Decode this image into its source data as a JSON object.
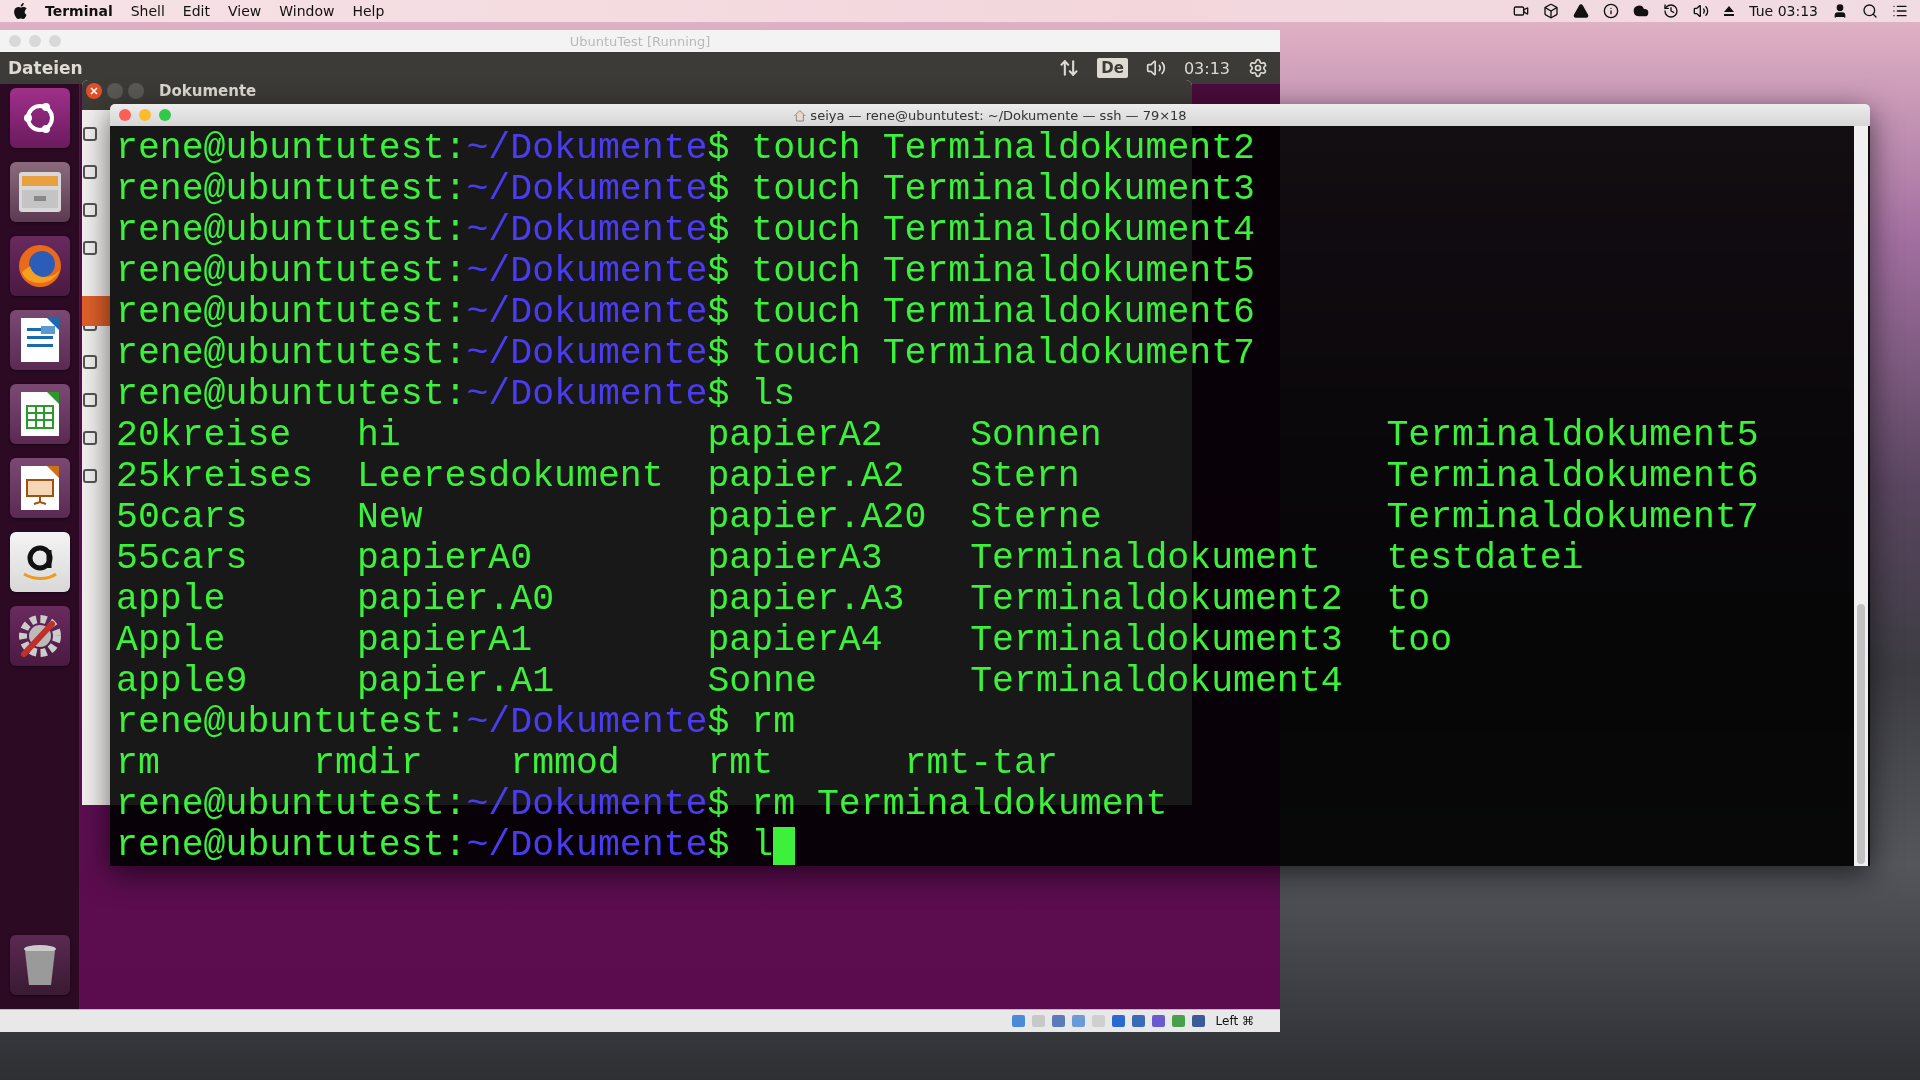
{
  "menu_bar": {
    "app": "Terminal",
    "items": [
      "Shell",
      "Edit",
      "View",
      "Window",
      "Help"
    ],
    "clock": "Tue 03:13"
  },
  "vm_window": {
    "title": "UbuntuTest [Running]",
    "panel_title": "Dateien",
    "keyboard_layout": "De",
    "clock": "03:13",
    "host_key": "Left ⌘"
  },
  "file_window": {
    "title": "Dokumente"
  },
  "terminal": {
    "title": "seiya — rene@ubuntutest: ~/Dokumente — ssh — 79×18",
    "lines": [
      {
        "kind": "prompt",
        "user_host": "rene@ubuntutest:",
        "path": "~/Dokumente",
        "symbol": "$",
        "command": "touch Terminaldokument2",
        "cursor": false
      },
      {
        "kind": "prompt",
        "user_host": "rene@ubuntutest:",
        "path": "~/Dokumente",
        "symbol": "$",
        "command": "touch Terminaldokument3",
        "cursor": false
      },
      {
        "kind": "prompt",
        "user_host": "rene@ubuntutest:",
        "path": "~/Dokumente",
        "symbol": "$",
        "command": "touch Terminaldokument4",
        "cursor": false
      },
      {
        "kind": "prompt",
        "user_host": "rene@ubuntutest:",
        "path": "~/Dokumente",
        "symbol": "$",
        "command": "touch Terminaldokument5",
        "cursor": false
      },
      {
        "kind": "prompt",
        "user_host": "rene@ubuntutest:",
        "path": "~/Dokumente",
        "symbol": "$",
        "command": "touch Terminaldokument6",
        "cursor": false
      },
      {
        "kind": "prompt",
        "user_host": "rene@ubuntutest:",
        "path": "~/Dokumente",
        "symbol": "$",
        "command": "touch Terminaldokument7",
        "cursor": false
      },
      {
        "kind": "prompt",
        "user_host": "rene@ubuntutest:",
        "path": "~/Dokumente",
        "symbol": "$",
        "command": "ls",
        "cursor": false
      },
      {
        "kind": "listing",
        "rows": [
          [
            "20kreise",
            "hi",
            "papierA2",
            "Sonnen",
            "Terminaldokument5"
          ],
          [
            "25kreises",
            "Leeresdokument",
            "papier.A2",
            "Stern",
            "Terminaldokument6"
          ],
          [
            "50cars",
            "New",
            "papier.A20",
            "Sterne",
            "Terminaldokument7"
          ],
          [
            "55cars",
            "papierA0",
            "papierA3",
            "Terminaldokument",
            "testdatei"
          ],
          [
            "apple",
            "papier.A0",
            "papier.A3",
            "Terminaldokument2",
            "to"
          ],
          [
            "Apple",
            "papierA1",
            "papierA4",
            "Terminaldokument3",
            "too"
          ],
          [
            "apple9",
            "papier.A1",
            "Sonne",
            "Terminaldokument4"
          ]
        ]
      },
      {
        "kind": "prompt",
        "user_host": "rene@ubuntutest:",
        "path": "~/Dokumente",
        "symbol": "$",
        "command": "rm",
        "cursor": false
      },
      {
        "kind": "completion",
        "items": [
          "rm",
          "rmdir",
          "rmmod",
          "rmt",
          "rmt-tar"
        ]
      },
      {
        "kind": "prompt",
        "user_host": "rene@ubuntutest:",
        "path": "~/Dokumente",
        "symbol": "$",
        "command": "rm Terminaldokument",
        "cursor": false
      },
      {
        "kind": "prompt",
        "user_host": "rene@ubuntutest:",
        "path": "~/Dokumente",
        "symbol": "$",
        "command": "l",
        "cursor": true
      }
    ]
  }
}
